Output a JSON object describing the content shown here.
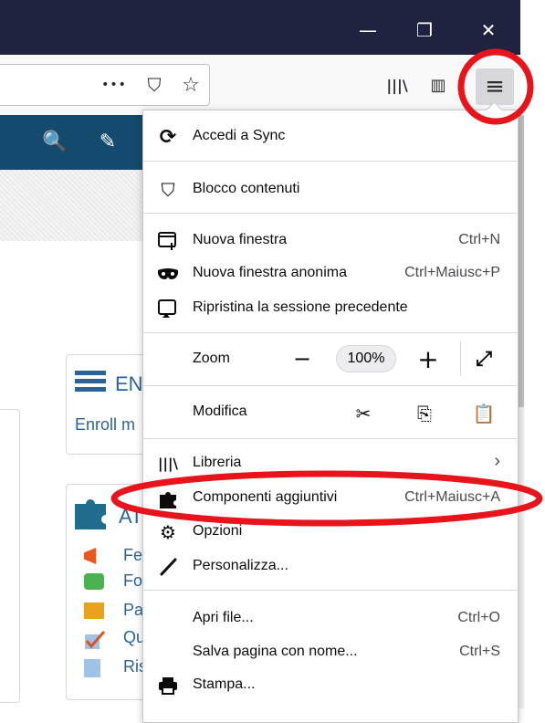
{
  "window": {
    "minimize_glyph": "—",
    "restore_glyph": "❐",
    "close_glyph": "✕"
  },
  "toolbar": {
    "page_actions_glyph": "•••",
    "pocket_glyph": "⛉",
    "bookmark_glyph": "☆",
    "library_glyph": "|||\\",
    "sidebar_glyph": "▥",
    "menu_glyph": "≡"
  },
  "site": {
    "search_glyph": "🔍",
    "edit_glyph": "✎",
    "card1": {
      "title": "EN",
      "link": "Enroll m"
    },
    "card2": {
      "title": "AT",
      "links": [
        "Fe",
        "Fo",
        "Pa",
        "Qu",
        "Ris"
      ]
    }
  },
  "menu": {
    "sync": "Accedi a Sync",
    "content_blocking": "Blocco contenuti",
    "new_window": {
      "label": "Nuova finestra",
      "shortcut": "Ctrl+N"
    },
    "private_window": {
      "label": "Nuova finestra anonima",
      "shortcut": "Ctrl+Maiusc+P"
    },
    "restore_session": "Ripristina la sessione precedente",
    "zoom": {
      "label": "Zoom",
      "minus": "−",
      "value": "100%",
      "plus": "+",
      "fullscreen": "⤢"
    },
    "edit": {
      "label": "Modifica",
      "cut": "✂",
      "copy": "⎘",
      "paste": "📋"
    },
    "library": {
      "label": "Libreria",
      "chevron": "›"
    },
    "addons": {
      "label": "Componenti aggiuntivi",
      "shortcut": "Ctrl+Maiusc+A"
    },
    "options": "Opzioni",
    "customize": "Personalizza...",
    "open_file": {
      "label": "Apri file...",
      "shortcut": "Ctrl+O"
    },
    "save_page": {
      "label": "Salva pagina con nome...",
      "shortcut": "Ctrl+S"
    },
    "print": "Stampa..."
  },
  "colors": {
    "titlebar": "#202340",
    "site_header": "#134a6d",
    "annotation_red": "#e8141b",
    "link_blue": "#2a6496"
  }
}
